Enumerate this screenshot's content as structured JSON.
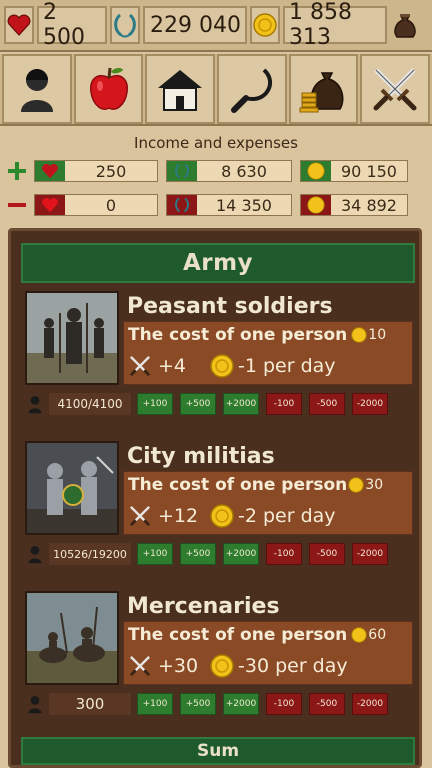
{
  "resources": {
    "health": "2 500",
    "laurel": "229 040",
    "gold": "1 858 313"
  },
  "icons": [
    "person-icon",
    "apple-icon",
    "house-icon",
    "sickle-icon",
    "money-bag-icon",
    "crossed-swords-icon"
  ],
  "income_expenses": {
    "title": "Income and expenses",
    "income": {
      "health": "250",
      "laurel": "8 630",
      "gold": "90 150"
    },
    "expenses": {
      "health": "0",
      "laurel": "14 350",
      "gold": "34 892"
    }
  },
  "army": {
    "title": "Army",
    "sum_label": "Sum",
    "units": [
      {
        "name": "Peasant soldiers",
        "cost_label": "The cost of one person",
        "cost": "10",
        "attack": "+4",
        "upkeep": "-1 per day",
        "count": "4100/4100"
      },
      {
        "name": "City militias",
        "cost_label": "The cost of one person",
        "cost": "30",
        "attack": "+12",
        "upkeep": "-2 per day",
        "count": "10526/19200"
      },
      {
        "name": "Mercenaries",
        "cost_label": "The cost of one person",
        "cost": "60",
        "attack": "+30",
        "upkeep": "-30 per day",
        "count": "300"
      }
    ],
    "buttons": {
      "add": [
        "+100",
        "+500",
        "+2000"
      ],
      "remove": [
        "-100",
        "-500",
        "-2000"
      ]
    }
  },
  "colors": {
    "accent_green": "#1f5a2c",
    "button_green": "#2e7d2e",
    "button_red": "#8b1717",
    "panel_brown": "#4a2e1e"
  }
}
